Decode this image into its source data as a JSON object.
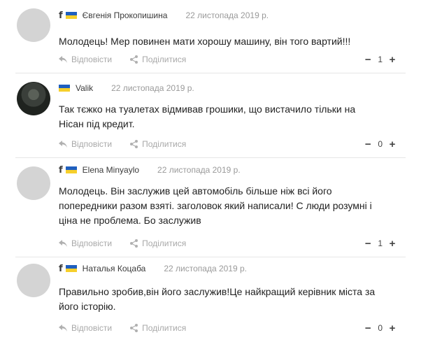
{
  "comments": [
    {
      "has_fb": true,
      "author": "Євгенія Прокопишина",
      "date": "22 листопада 2019 р.",
      "text_lines": [
        "Молодець! Мер повинен мати хорошу машину, він того вартий!!!"
      ],
      "reply_label": "Відповісти",
      "share_label": "Поділитися",
      "votes": "1",
      "avatar": "placeholder"
    },
    {
      "has_fb": false,
      "author": "Valik",
      "date": "22 листопада 2019 р.",
      "text_lines": [
        "Так тєжко на туалетах відмивав грошики, що вистачило тільки на",
        "Нісан під кредит."
      ],
      "reply_label": "Відповісти",
      "share_label": "Поділитися",
      "votes": "0",
      "avatar": "photo"
    },
    {
      "has_fb": true,
      "author": "Elena Minyaylo",
      "date": "22 листопада 2019 р.",
      "text_lines": [
        "Молодець. Він заслужив цей автомобіль більше ніж всі його",
        "попередники разом взяті. заголовок який написали! С люди розумні і",
        "ціна не проблема. Бо заслужив"
      ],
      "reply_label": "Відповісти",
      "share_label": "Поділитися",
      "votes": "1",
      "avatar": "placeholder"
    },
    {
      "has_fb": true,
      "author": "Наталья Коцаба",
      "date": "22 листопада 2019 р.",
      "text_lines": [
        "Правильно зробив,він його заслужив!Це найкращий керівник міста за",
        "його історію."
      ],
      "reply_label": "Відповісти",
      "share_label": "Поділитися",
      "votes": "0",
      "avatar": "placeholder"
    }
  ],
  "icons": {
    "facebook": "f",
    "reply": "reply-icon",
    "share": "share-icon",
    "downvote": "−",
    "upvote": "+"
  },
  "colors": {
    "flag_blue": "#1f5fbf",
    "flag_yellow": "#f6cf2b",
    "avatar_placeholder": "#d4d4d4",
    "muted_text": "#a8a8a8"
  }
}
